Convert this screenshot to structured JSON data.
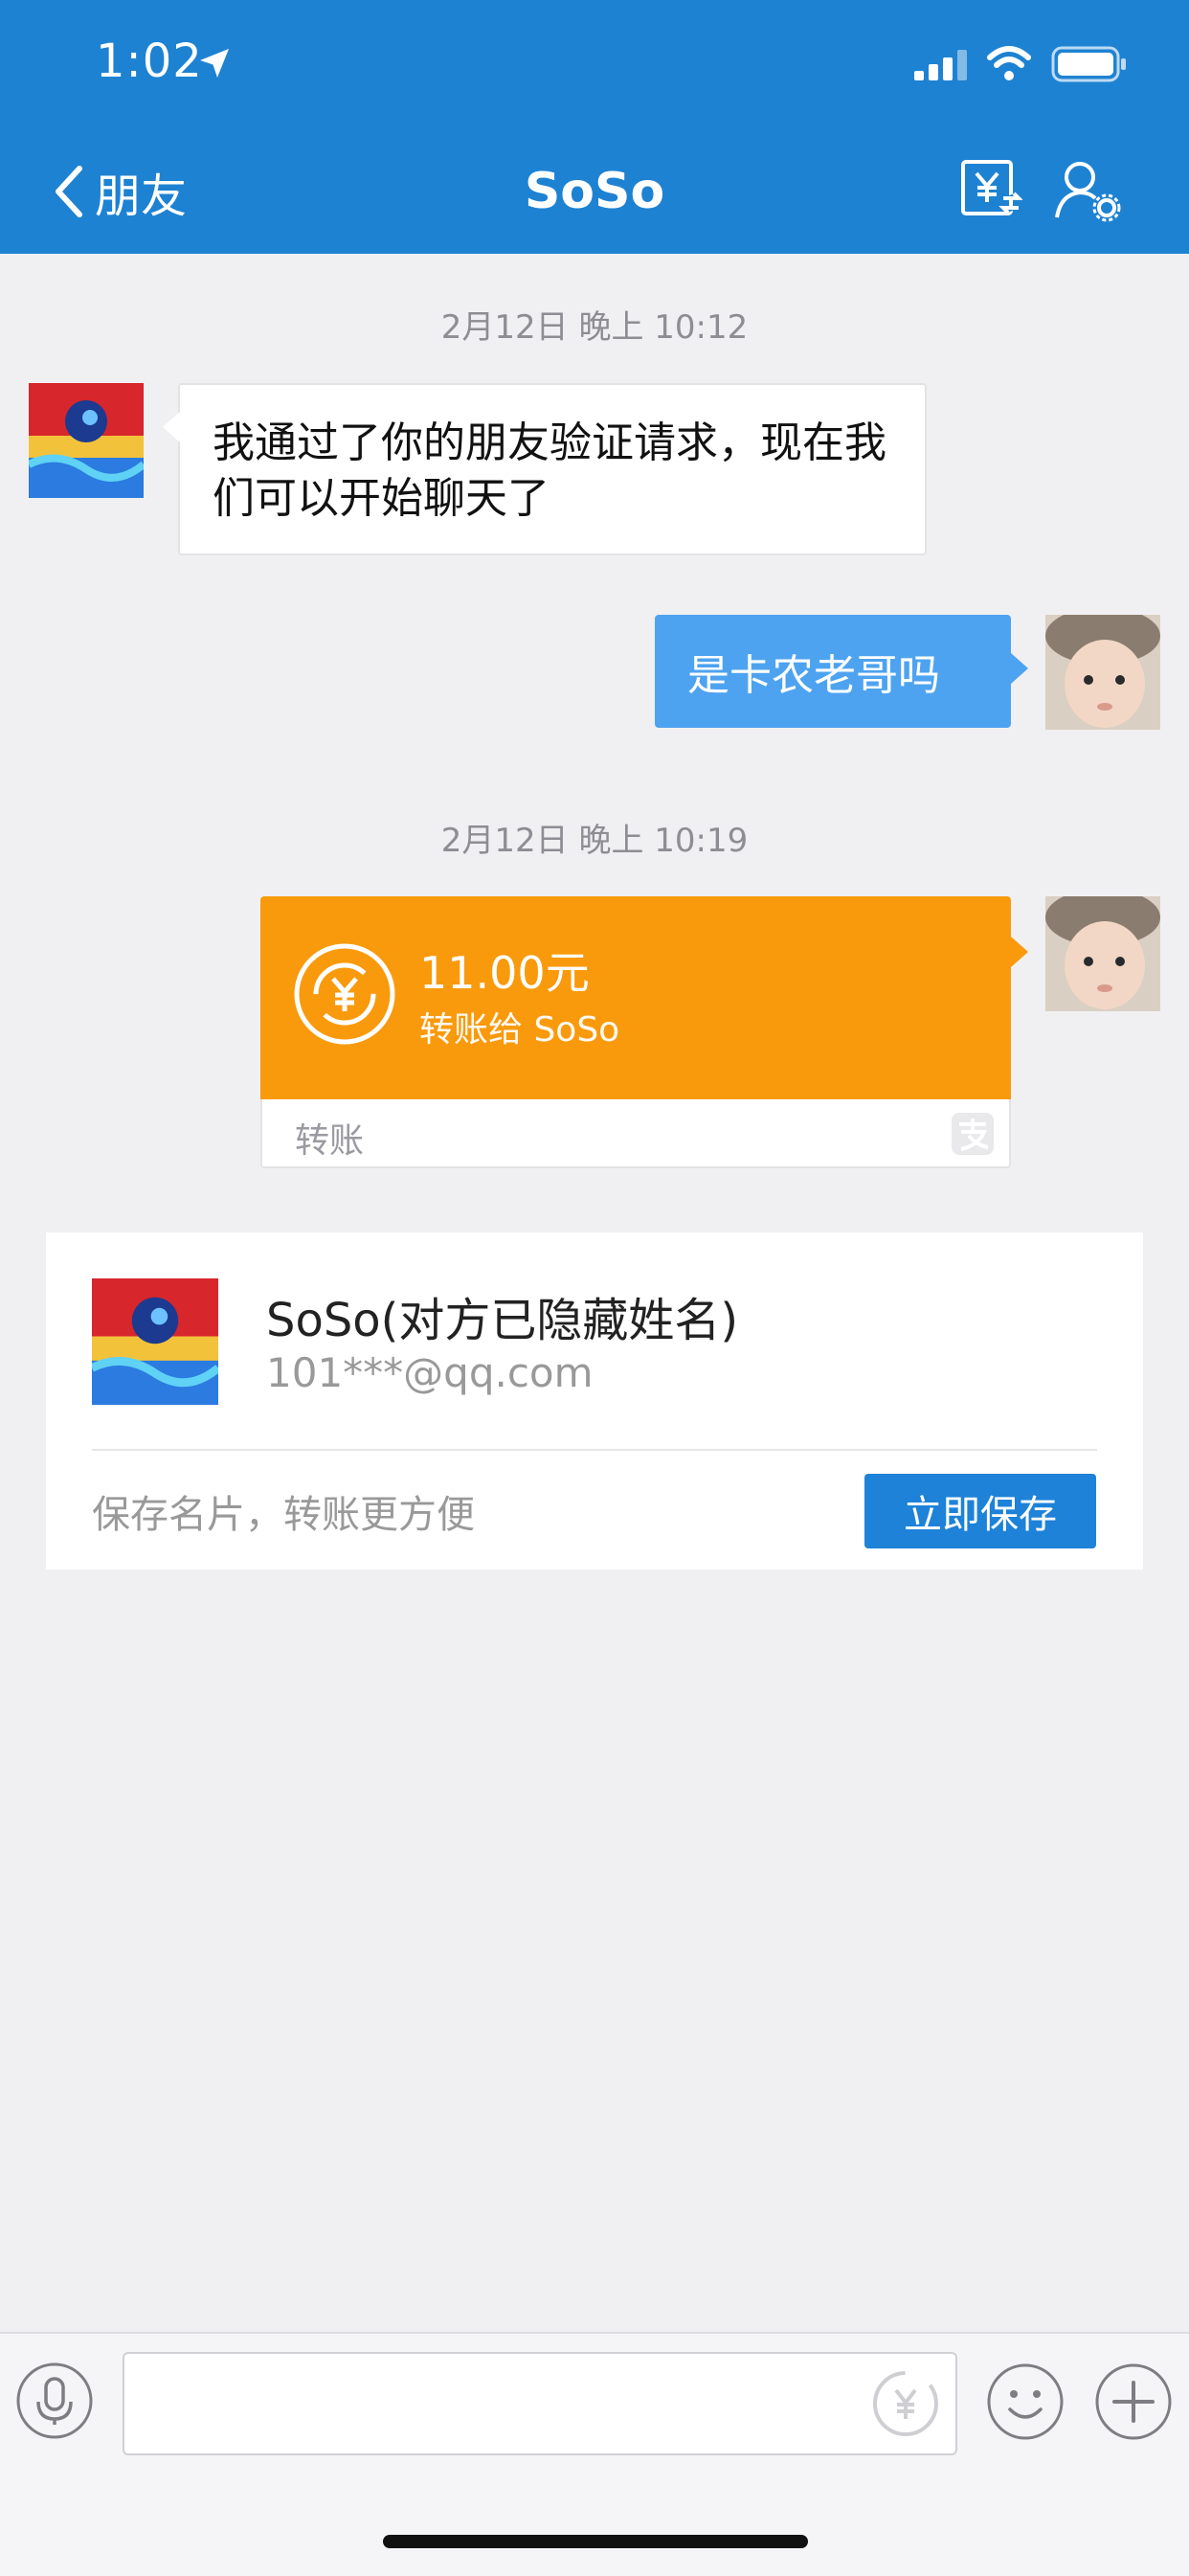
{
  "status_bar": {
    "time": "1:02"
  },
  "header": {
    "back_label": "朋友",
    "title": "SoSo"
  },
  "messages": {
    "timestamp_1": "2月12日 晚上 10:12",
    "received_1": "我通过了你的朋友验证请求，现在我们可以开始聊天了",
    "sent_1": "是卡农老哥吗",
    "timestamp_2": "2月12日 晚上 10:19"
  },
  "transfer": {
    "amount": "11.00元",
    "to": "转账给 SoSo",
    "label": "转账"
  },
  "contact_card": {
    "name": "SoSo(对方已隐藏姓名)",
    "email": "101***@qq.com",
    "hint": "保存名片，转账更方便",
    "save_button": "立即保存"
  },
  "icons": {
    "back": "chevron-left-icon",
    "transfer": "yuan-transfer-icon",
    "profile": "user-settings-icon",
    "mic": "microphone-icon",
    "emoji": "smiley-icon",
    "plus": "plus-icon",
    "alipay": "alipay-icon"
  },
  "colors": {
    "header": "#1e82d2",
    "sent_bubble": "#4ea3f0",
    "transfer": "#f99a0c",
    "save_button": "#1d82d8"
  }
}
